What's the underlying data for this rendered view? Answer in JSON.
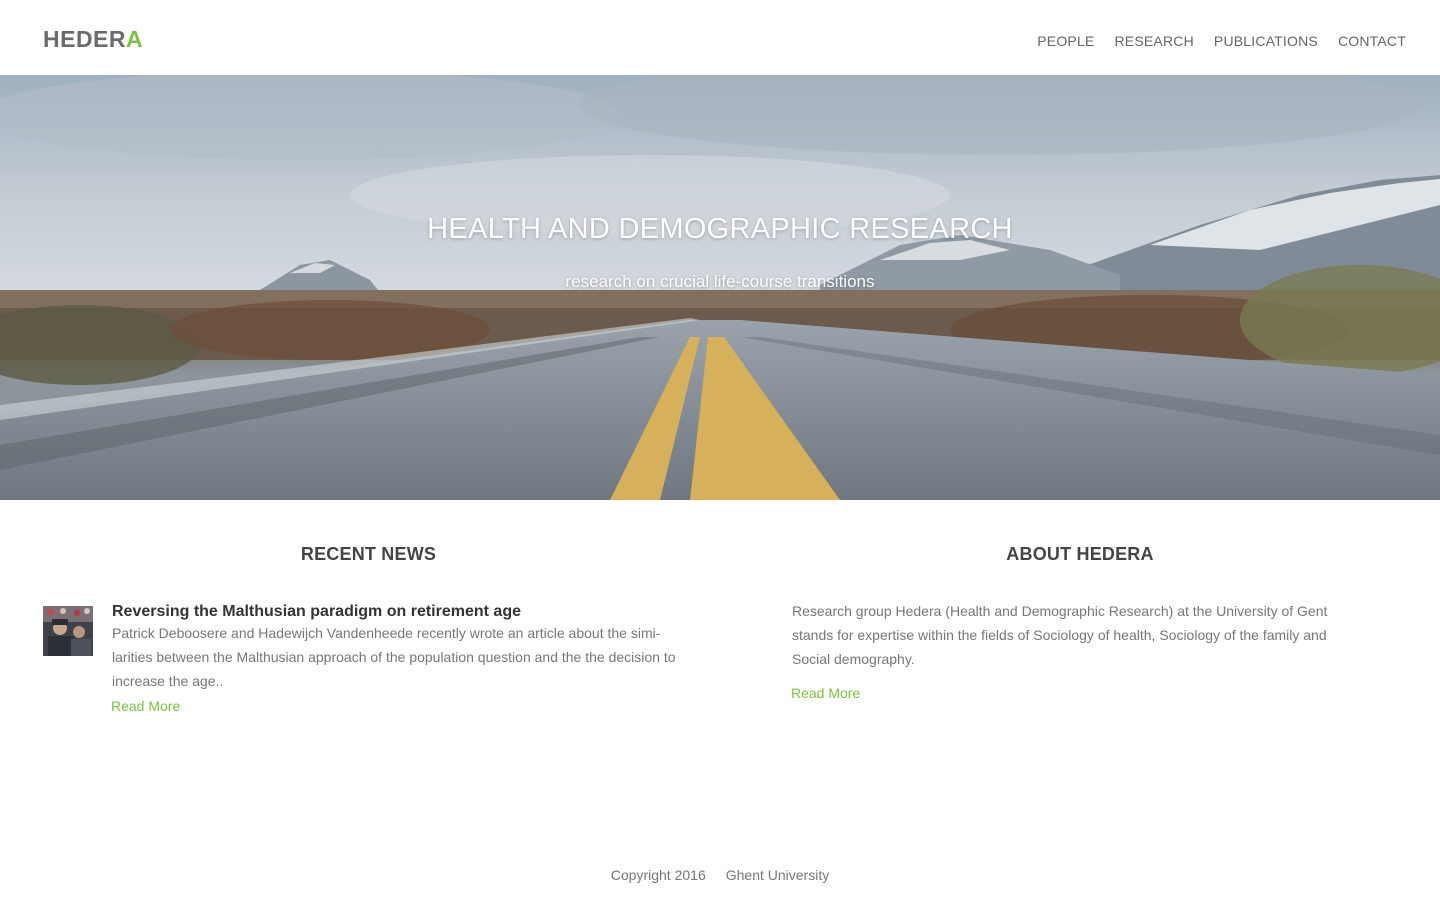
{
  "header": {
    "logo_main": "HEDER",
    "logo_accent": "A",
    "nav": [
      "PEOPLE",
      "RESEARCH",
      "PUBLICATIONS",
      "CONTACT"
    ]
  },
  "hero": {
    "title": "HEALTH AND DEMOGRAPHIC RESEARCH",
    "subtitle": "research on crucial life-course transitions"
  },
  "news": {
    "section_title": "RECENT NEWS",
    "item": {
      "headline": "Reversing the Malthusian paradigm on retirement age",
      "body": "Patrick Deboosere and Hadewijch Vandenheede recently wrote an article about the simi-larities between the Malthusian approach of the population question and the the decision to increase the age..",
      "read_more": "Read More"
    }
  },
  "about": {
    "section_title": "ABOUT HEDERA",
    "body": "Research group Hedera (Health and Demographic Research) at the University of Gent stands for expertise within the fields of Sociology of health, Sociology of the family and Social demography.",
    "read_more": "Read More"
  },
  "footer": {
    "copyright": "Copyright 2016",
    "university": "Ghent University"
  },
  "colors": {
    "accent": "#7cc142",
    "text": "#777777",
    "heading": "#444444"
  }
}
